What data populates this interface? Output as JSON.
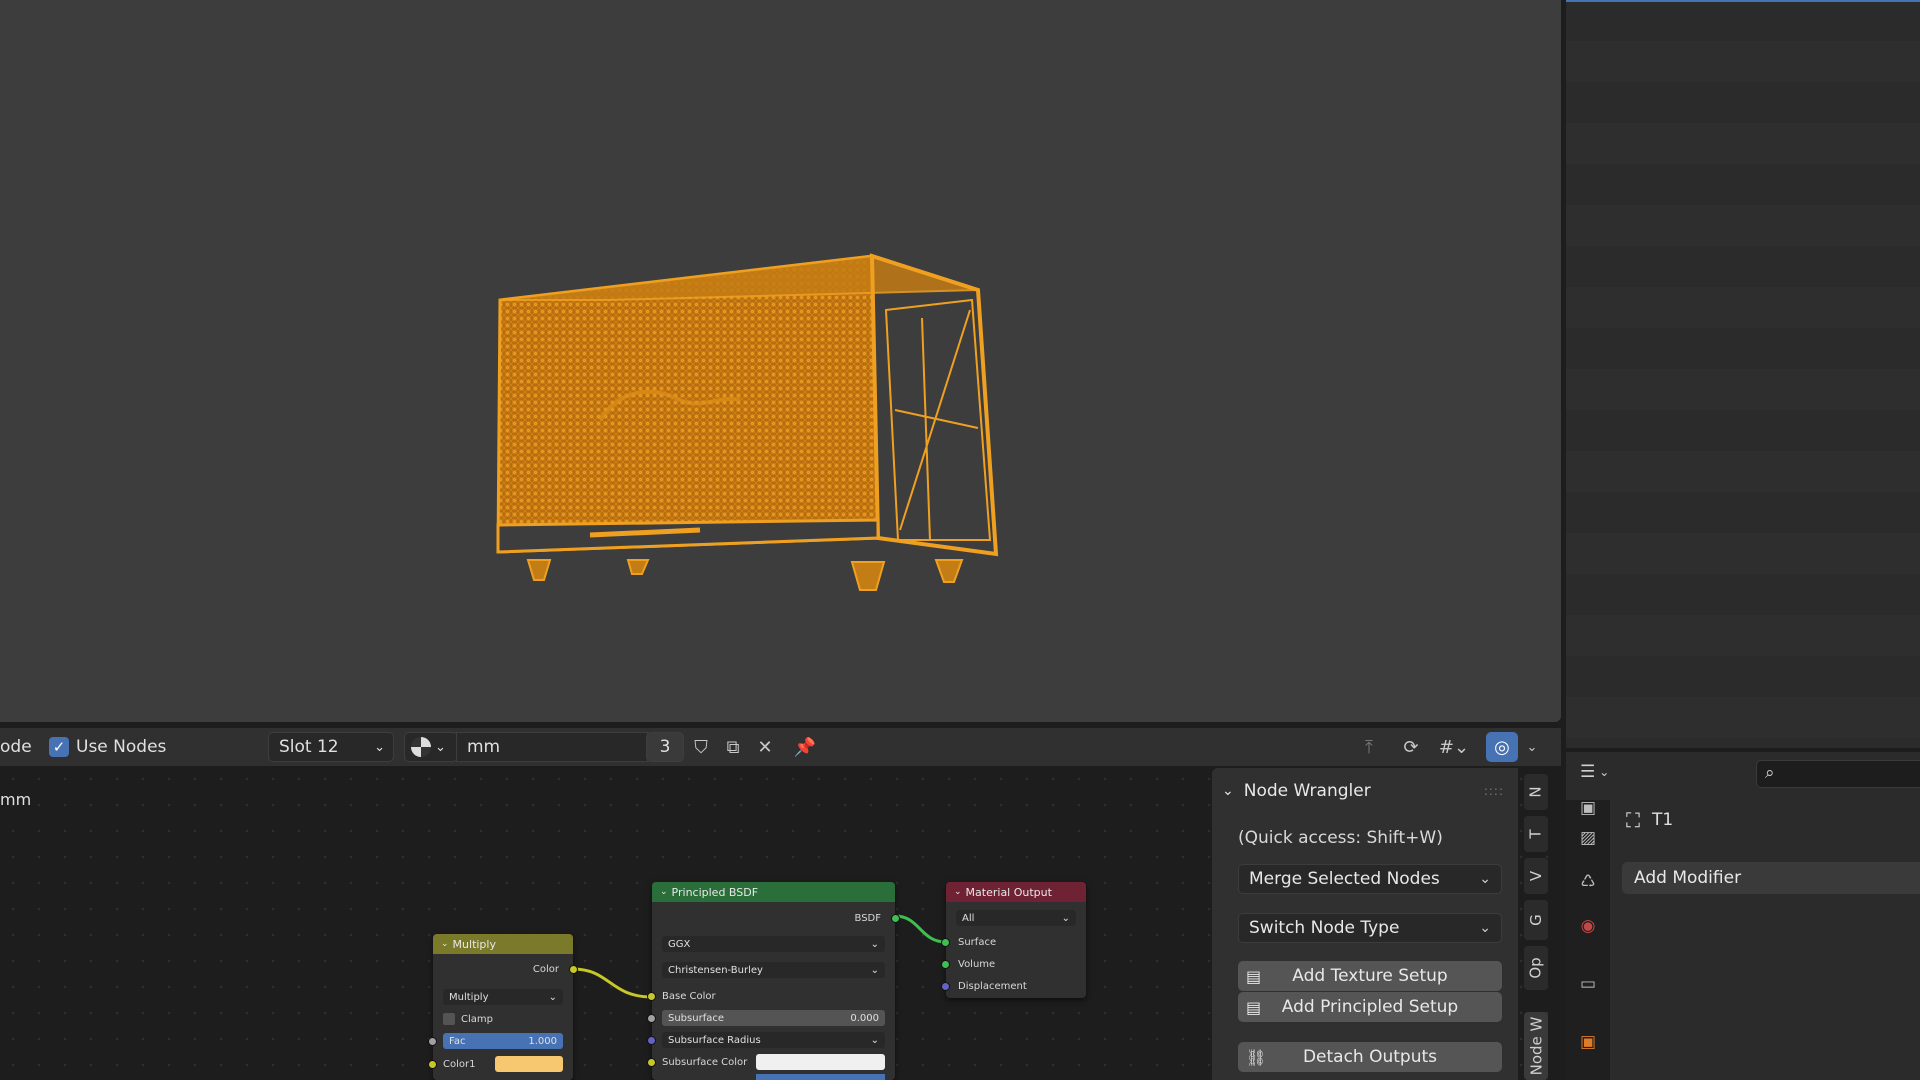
{
  "header": {
    "mode_fragment": "ode",
    "use_nodes_label": "Use Nodes",
    "slot_label": "Slot 12",
    "material_name": "mm",
    "user_count": "3"
  },
  "canvas": {
    "material_name_fragment": "mm"
  },
  "nodes": {
    "multiply": {
      "title": "Multiply",
      "output_label": "Color",
      "blend_mode": "Multiply",
      "clamp_label": "Clamp",
      "fac_label": "Fac",
      "fac_value": "1.000",
      "color1_label": "Color1"
    },
    "principled": {
      "title": "Principled BSDF",
      "output_label": "BSDF",
      "distribution": "GGX",
      "subsurface_method": "Christensen-Burley",
      "base_color_label": "Base Color",
      "subsurface_label": "Subsurface",
      "subsurface_value": "0.000",
      "subsurface_radius_label": "Subsurface Radius",
      "subsurface_color_label": "Subsurface Color"
    },
    "material_output": {
      "title": "Material Output",
      "target": "All",
      "surface_label": "Surface",
      "volume_label": "Volume",
      "displacement_label": "Displacement"
    }
  },
  "node_wrangler": {
    "title": "Node Wrangler",
    "quick_access": "(Quick access: Shift+W)",
    "merge_selected": "Merge Selected Nodes",
    "switch_node_type": "Switch Node Type",
    "add_texture_setup": "Add Texture Setup",
    "add_principled_setup": "Add Principled Setup",
    "detach_outputs": "Detach Outputs"
  },
  "side_tabs": [
    "N",
    "T",
    "V",
    "G",
    "Op",
    "Node W"
  ],
  "properties": {
    "object_name": "T1",
    "add_modifier": "Add Modifier"
  },
  "colors": {
    "wireframe": "#f0a020",
    "viewport_bg": "#3d3d3d",
    "accent": "#4772b3",
    "multiply_header": "#7a7a2a",
    "principled_header": "#2a6e3a",
    "output_header": "#6e2233",
    "color_socket": "#c7c729",
    "shader_socket": "#3fbf4f",
    "vector_socket": "#6363c7",
    "float_socket": "#a1a1a1"
  }
}
